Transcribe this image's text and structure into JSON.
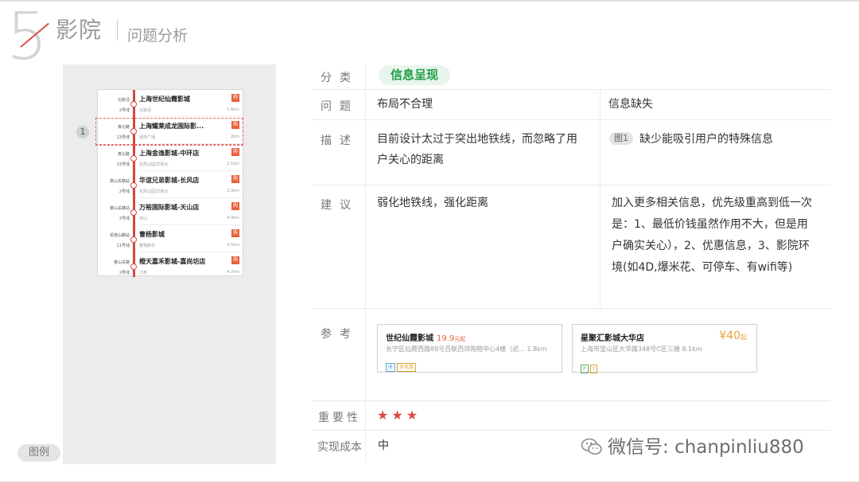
{
  "header": {
    "section_number": "5",
    "title": "影院",
    "subtitle": "问题分析"
  },
  "example_panel": {
    "legend": "图例",
    "marker": "1",
    "cinemas": [
      {
        "station": "北新泾",
        "line": "2号线",
        "name": "上海世纪仙霞影城",
        "addr": "北新泾",
        "dist": "1.8km",
        "tag": "购"
      },
      {
        "station": "真北路",
        "line": "13号线",
        "name": "上海耀莱成龙国际影...",
        "addr": "城市广场",
        "dist": "2km",
        "tag": "购"
      },
      {
        "station": "真北路",
        "line": "13号线",
        "name": "上海金逸影城-中环店",
        "addr": "长风公园/华师大",
        "dist": "2.1km",
        "tag": "购"
      },
      {
        "station": "娄山关路站",
        "line": "2号线",
        "name": "华谊兄弟影城-长风店",
        "addr": "长风公园/华师大",
        "dist": "3.3km",
        "tag": "购"
      },
      {
        "station": "娄山关路站",
        "line": "2号线",
        "name": "万裕国际影城-天山店",
        "addr": "天山",
        "dist": "4.4km",
        "tag": "购"
      },
      {
        "station": "祁连山路站",
        "line": "11号线",
        "name": "曹杨影城",
        "addr": "曹杨新村",
        "dist": "4.5km",
        "tag": "购"
      },
      {
        "station": "娄山关路",
        "line": "2号线",
        "name": "橙天嘉禾影城-嘉尚坊店",
        "addr": "江桥",
        "dist": "4.7km",
        "tag": "购"
      }
    ]
  },
  "table": {
    "category": {
      "label": "分类",
      "value": "信息呈现"
    },
    "problem": {
      "label": "问题",
      "col1": "布局不合理",
      "col2": "信息缺失"
    },
    "description": {
      "label": "描述",
      "col1_line1": "目前设计太过于突出地铁线，而忽略了用",
      "col1_line2": "户关心的距离",
      "col2_tag": "图1",
      "col2_text": "缺少能吸引用户的特殊信息"
    },
    "suggestion": {
      "label": "建议",
      "col1": "弱化地铁线，强化距离",
      "col2_lines": [
        "加入更多相关信息，优先级重高到低一次",
        "是：1、最低价钱虽然作用不大，但是用",
        "户确实关心），2、优惠信息，3、影院环",
        "境(如4D,爆米花、可停车、有wifi等)"
      ]
    },
    "reference": {
      "label": "参考",
      "card1": {
        "name": "世纪仙霞影城",
        "price": "19.9",
        "price_unit": "元起",
        "addr": "长宁区仙霞西路88号百联西郊购物中心4楼（近... 1.8km",
        "tags": [
          "座",
          "多优惠"
        ]
      },
      "card2": {
        "name": "星聚汇影城大华店",
        "price": "¥40",
        "price_unit": "起",
        "addr": "上海市宝山区大华路348号C区三楼  8.1km",
        "tags": [
          "P",
          "Y"
        ]
      }
    },
    "importance": {
      "label": "重要性",
      "stars": "★★★",
      "rating": 3
    },
    "cost": {
      "label": "实现成本",
      "value": "中"
    }
  },
  "watermark": "微信号: chanpinliu880",
  "colors": {
    "accent_red": "#d94848",
    "accent_green": "#1f9d47",
    "tag_orange": "#e8603c"
  }
}
